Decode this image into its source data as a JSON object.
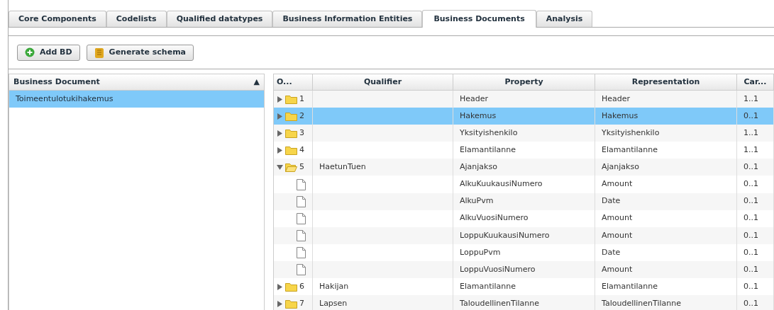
{
  "tabs": [
    {
      "label": "Core Components",
      "selected": false
    },
    {
      "label": "Codelists",
      "selected": false
    },
    {
      "label": "Qualified datatypes",
      "selected": false
    },
    {
      "label": "Business Information Entities",
      "selected": false
    },
    {
      "label": "Business Documents",
      "selected": true
    },
    {
      "label": "Analysis",
      "selected": false
    }
  ],
  "toolbar": {
    "buttons": [
      {
        "label": "Add BD",
        "kind": "add"
      },
      {
        "label": "Generate schema",
        "kind": "schema"
      }
    ]
  },
  "documents_grid": {
    "column": "Business Document",
    "sort": "▲",
    "rows": [
      {
        "name": "Toimeentulotukihakemus",
        "selected": true
      }
    ]
  },
  "structure_grid": {
    "columns": [
      "O...",
      "Qualifier",
      "Property",
      "Representation",
      "Car..."
    ],
    "rows": [
      {
        "kind": "folder",
        "expanded": false,
        "order": "1",
        "qualifier": "",
        "property": "Header",
        "representation": "Header",
        "cardinality": "1..1",
        "selected": false
      },
      {
        "kind": "folder",
        "expanded": false,
        "order": "2",
        "qualifier": "",
        "property": "Hakemus",
        "representation": "Hakemus",
        "cardinality": "0..1",
        "selected": true
      },
      {
        "kind": "folder",
        "expanded": false,
        "order": "3",
        "qualifier": "",
        "property": "Yksityishenkilo",
        "representation": "Yksityishenkilo",
        "cardinality": "1..1",
        "selected": false
      },
      {
        "kind": "folder",
        "expanded": false,
        "order": "4",
        "qualifier": "",
        "property": "Elamantilanne",
        "representation": "Elamantilanne",
        "cardinality": "1..1",
        "selected": false
      },
      {
        "kind": "folder",
        "expanded": true,
        "order": "5",
        "qualifier": "HaetunTuen",
        "property": "Ajanjakso",
        "representation": "Ajanjakso",
        "cardinality": "0..1",
        "selected": false
      },
      {
        "kind": "leaf",
        "property": "AlkuKuukausiNumero",
        "representation": "Amount",
        "cardinality": "0..1",
        "selected": false
      },
      {
        "kind": "leaf",
        "property": "AlkuPvm",
        "representation": "Date",
        "cardinality": "0..1",
        "selected": false
      },
      {
        "kind": "leaf",
        "property": "AlkuVuosiNumero",
        "representation": "Amount",
        "cardinality": "0..1",
        "selected": false
      },
      {
        "kind": "leaf",
        "property": "LoppuKuukausiNumero",
        "representation": "Amount",
        "cardinality": "0..1",
        "selected": false
      },
      {
        "kind": "leaf",
        "property": "LoppuPvm",
        "representation": "Date",
        "cardinality": "0..1",
        "selected": false
      },
      {
        "kind": "leaf",
        "property": "LoppuVuosiNumero",
        "representation": "Amount",
        "cardinality": "0..1",
        "selected": false
      },
      {
        "kind": "folder",
        "expanded": false,
        "order": "6",
        "qualifier": "Hakijan",
        "property": "Elamantilanne",
        "representation": "Elamantilanne",
        "cardinality": "0..1",
        "selected": false
      },
      {
        "kind": "folder",
        "expanded": false,
        "order": "7",
        "qualifier": "Lapsen",
        "property": "TaloudellinenTilanne",
        "representation": "TaloudellinenTilanne",
        "cardinality": "0..1",
        "selected": false
      }
    ]
  }
}
